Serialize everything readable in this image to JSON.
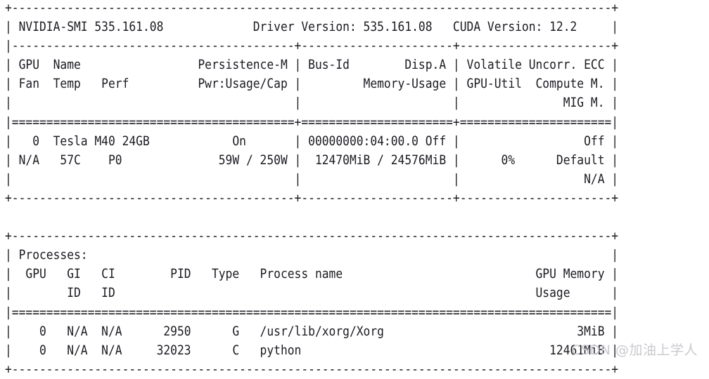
{
  "terminal": {
    "command_output_type": "nvidia-smi",
    "background_color": "#ffffff",
    "text_color": "#1b1b22",
    "header": {
      "smi_label": "NVIDIA-SMI",
      "smi_version": "535.161.08",
      "driver_label": "Driver Version:",
      "driver_version": "535.161.08",
      "cuda_label": "CUDA Version:",
      "cuda_version": "12.2"
    },
    "gpu_table": {
      "columns_row1": [
        "GPU",
        "Name",
        "Persistence-M",
        "Bus-Id",
        "Disp.A",
        "Volatile Uncorr. ECC"
      ],
      "columns_row2": [
        "Fan",
        "Temp",
        "Perf",
        "Pwr:Usage/Cap",
        "Memory-Usage",
        "GPU-Util",
        "Compute M."
      ],
      "columns_row3": [
        "MIG M."
      ],
      "rows": [
        {
          "gpu": "0",
          "name": "Tesla M40 24GB",
          "persistence_m": "On",
          "bus_id": "00000000:04:00.0",
          "disp_a": "Off",
          "ecc": "Off",
          "fan": "N/A",
          "temp": "57C",
          "perf": "P0",
          "pwr_usage_cap": "59W / 250W",
          "memory_usage": "12470MiB / 24576MiB",
          "gpu_util": "0%",
          "compute_m": "Default",
          "mig_m": "N/A"
        }
      ]
    },
    "processes_table": {
      "title": "Processes:",
      "columns_row1": [
        "GPU",
        "GI",
        "CI",
        "PID",
        "Type",
        "Process name",
        "GPU Memory"
      ],
      "columns_row2": [
        "ID",
        "ID",
        "Usage"
      ],
      "rows": [
        {
          "gpu": "0",
          "gi_id": "N/A",
          "ci_id": "N/A",
          "pid": "2950",
          "type": "G",
          "process_name": "/usr/lib/xorg/Xorg",
          "gpu_memory_usage": "3MiB"
        },
        {
          "gpu": "0",
          "gi_id": "N/A",
          "ci_id": "N/A",
          "pid": "32023",
          "type": "C",
          "process_name": "python",
          "gpu_memory_usage": "12461MiB"
        }
      ]
    },
    "raw_lines": [
      "+---------------------------------------------------------------------------------------+",
      "| NVIDIA-SMI 535.161.08             Driver Version: 535.161.08   CUDA Version: 12.2     |",
      "|-----------------------------------------+----------------------+----------------------+",
      "| GPU  Name                 Persistence-M | Bus-Id        Disp.A | Volatile Uncorr. ECC |",
      "| Fan  Temp   Perf          Pwr:Usage/Cap |         Memory-Usage | GPU-Util  Compute M. |",
      "|                                         |                      |               MIG M. |",
      "|=========================================+======================+======================|",
      "|   0  Tesla M40 24GB            On       | 00000000:04:00.0 Off |                  Off |",
      "| N/A   57C    P0              59W / 250W |  12470MiB / 24576MiB |      0%      Default |",
      "|                                         |                      |                  N/A |",
      "+-----------------------------------------+----------------------+----------------------+",
      "",
      "+---------------------------------------------------------------------------------------+",
      "| Processes:                                                                            |",
      "|  GPU   GI   CI        PID   Type   Process name                            GPU Memory |",
      "|        ID   ID                                                             Usage      |",
      "|=======================================================================================|",
      "|    0   N/A  N/A      2950      G   /usr/lib/xorg/Xorg                            3MiB |",
      "|    0   N/A  N/A     32023      C   python                                    12461MiB |",
      "+---------------------------------------------------------------------------------------+"
    ]
  },
  "watermark": {
    "text": "CSDN @加油上学人",
    "color": "#c9c9cf"
  }
}
